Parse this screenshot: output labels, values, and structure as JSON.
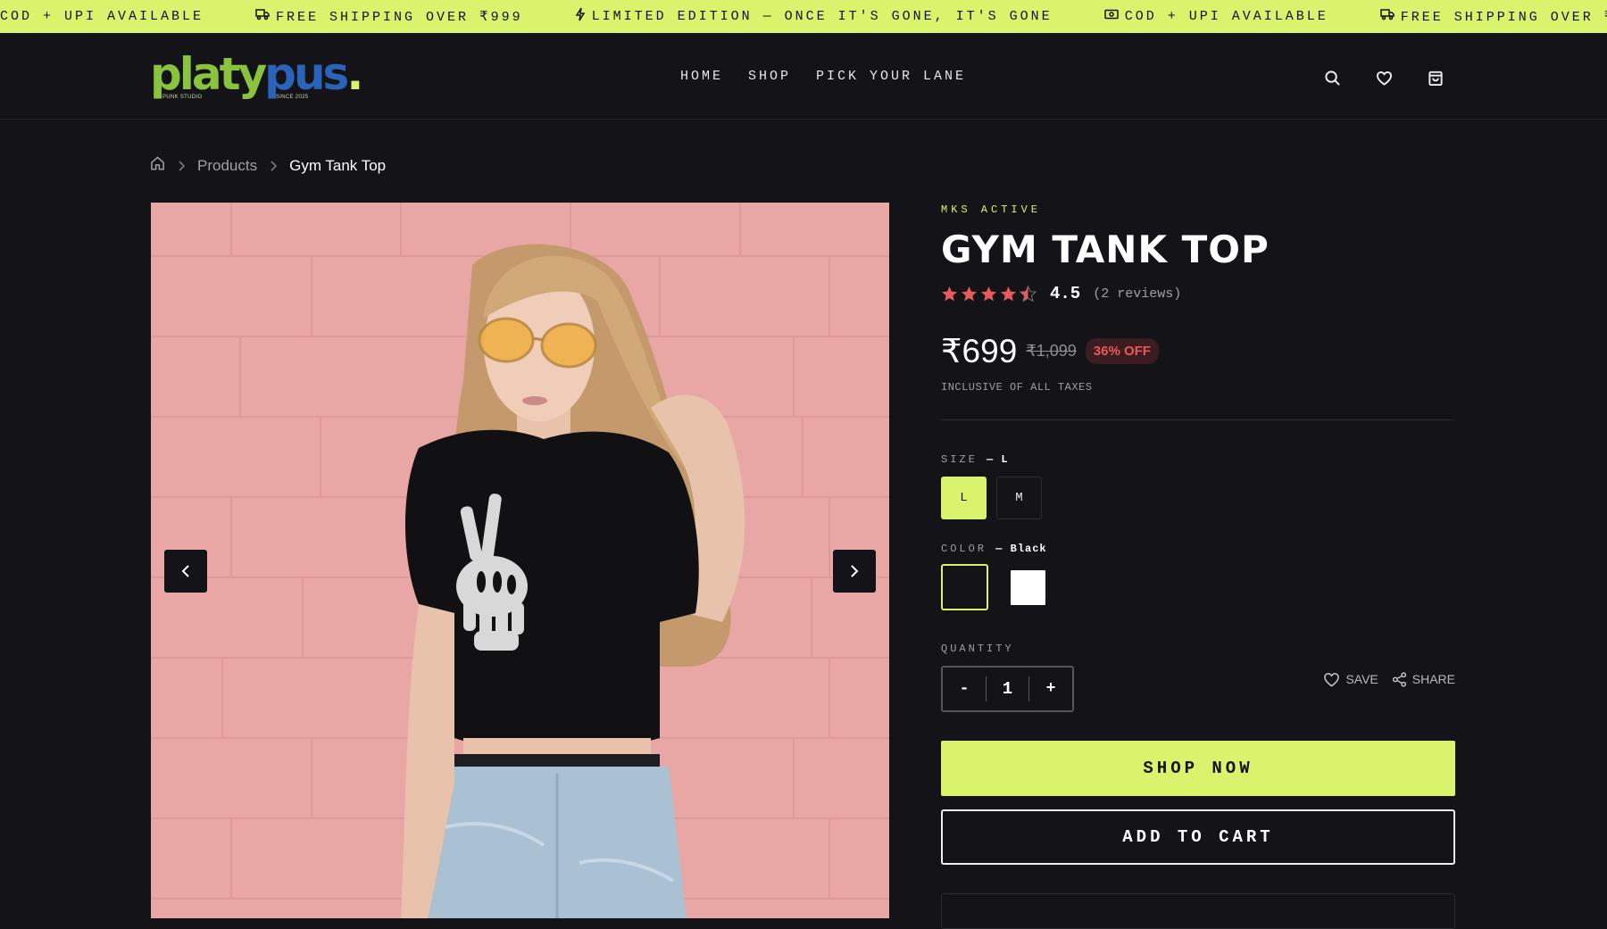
{
  "announcement": {
    "items": [
      {
        "icon": "none",
        "text": "COD + UPI AVAILABLE"
      },
      {
        "icon": "truck-icon",
        "text": "FREE SHIPPING OVER ₹999"
      },
      {
        "icon": "bolt-icon",
        "text": "LIMITED EDITION — ONCE IT'S GONE, IT'S GONE"
      },
      {
        "icon": "cash-icon",
        "text": "COD + UPI AVAILABLE"
      },
      {
        "icon": "truck-icon",
        "text": "FREE SHIPPING OVER ₹999"
      }
    ]
  },
  "header": {
    "logo": {
      "part1": "platy",
      "part2": "pus",
      "dot": ".",
      "tag_left": "PUNK STUDIO",
      "tag_right": "SINCE 2025"
    },
    "nav": [
      {
        "label": "HOME"
      },
      {
        "label": "SHOP"
      },
      {
        "label": "PICK YOUR LANE"
      }
    ],
    "icons": [
      "search-icon",
      "heart-icon",
      "bag-icon"
    ]
  },
  "breadcrumb": {
    "items": [
      "Products",
      "Gym Tank Top"
    ]
  },
  "product": {
    "brand": "MKS ACTIVE",
    "title": "GYM TANK TOP",
    "rating": {
      "value": 4.5,
      "score_text": "4.5",
      "reviews_text": "(2 reviews)",
      "max": 5
    },
    "price": "₹699",
    "mrp": "₹1,099",
    "discount": "36% OFF",
    "taxes_note": "INCLUSIVE OF ALL TAXES",
    "size": {
      "label": "SIZE",
      "selected_text": "— L",
      "options": [
        "L",
        "M"
      ],
      "selected": "L"
    },
    "color": {
      "label": "COLOR",
      "selected_text": "— Black",
      "options": [
        {
          "name": "Black",
          "hex": "#131318"
        },
        {
          "name": "White",
          "hex": "#ffffff"
        }
      ],
      "selected": "Black"
    },
    "quantity": {
      "label": "QUANTITY",
      "minus": "-",
      "value": "1",
      "plus": "+"
    },
    "save_label": "SAVE",
    "share_label": "SHARE",
    "shop_now_label": "SHOP NOW",
    "add_to_cart_label": "ADD TO CART"
  },
  "colors": {
    "accent": "#d9f36c",
    "background": "#131318",
    "star": "#e85a5a",
    "discount_text": "#e85a5a"
  }
}
